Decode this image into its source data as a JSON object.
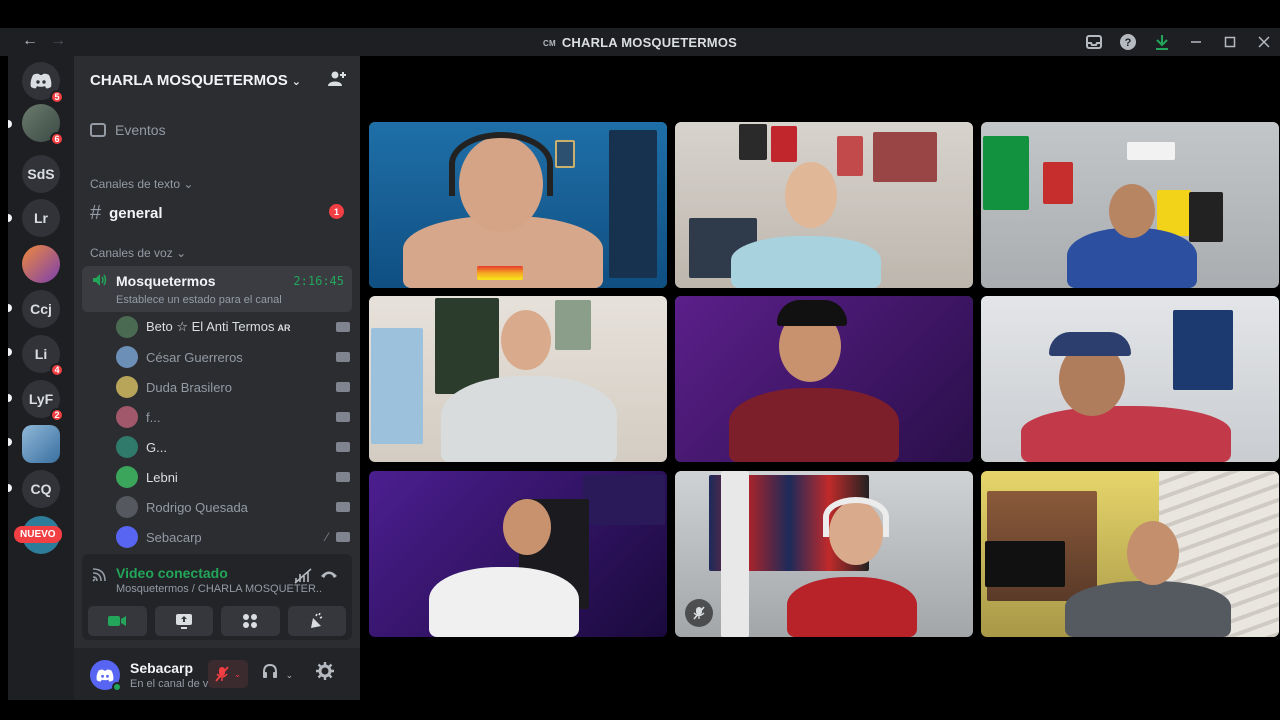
{
  "titlebar": {
    "back": "←",
    "forward": "→",
    "badge": "CM",
    "title": "CHARLA MOSQUETERMOS",
    "icons": [
      "inbox-icon",
      "help-icon",
      "download-icon",
      "minimize-icon",
      "maximize-icon",
      "close-icon"
    ]
  },
  "rail": {
    "guilds": [
      {
        "label": "",
        "icon": "discord-icon",
        "badge": "5"
      },
      {
        "label": "",
        "icon": "avatar",
        "badge": "6"
      },
      {
        "label": "SdS",
        "badge": ""
      },
      {
        "label": "Lr",
        "badge": ""
      },
      {
        "label": "",
        "icon": "avatar",
        "badge": ""
      },
      {
        "label": "Ccj",
        "badge": ""
      },
      {
        "label": "Li",
        "badge": "4"
      },
      {
        "label": "LyF",
        "badge": "2"
      },
      {
        "label": "",
        "icon": "avatar",
        "badge": ""
      },
      {
        "label": "CQ",
        "badge": ""
      }
    ],
    "new_label": "NUEVO"
  },
  "sidebar": {
    "server_name": "CHARLA MOSQUETERMOS",
    "events_label": "Eventos",
    "text_category": "Canales de texto",
    "text_channel": "general",
    "text_unread": "1",
    "voice_category": "Canales de voz",
    "voice_channel": {
      "name": "Mosquetermos",
      "time": "2:16:45",
      "status": "Establece un estado para el canal"
    },
    "members": [
      {
        "name": "Beto ☆ El Anti Termos",
        "flag": "AR",
        "bright": true,
        "icon": "camera-icon"
      },
      {
        "name": "César Guerreros",
        "flag": "",
        "bright": false,
        "icon": "camera-icon"
      },
      {
        "name": "Duda Brasilero",
        "flag": "",
        "bright": false,
        "icon": "camera-icon"
      },
      {
        "name": "f...",
        "flag": "",
        "bright": false,
        "icon": "camera-icon"
      },
      {
        "name": "G...",
        "flag": "",
        "bright": true,
        "icon": "camera-icon"
      },
      {
        "name": "Lebni",
        "flag": "",
        "bright": true,
        "icon": "camera-icon"
      },
      {
        "name": "Rodrigo Quesada",
        "flag": "",
        "bright": false,
        "icon": "camera-icon"
      },
      {
        "name": "Sebacarp",
        "flag": "",
        "bright": false,
        "icon": "camera-icon"
      }
    ]
  },
  "voice_panel": {
    "title": "Video conectado",
    "subtitle": "Mosquetermos / CHARLA MOSQUETER...",
    "buttons": [
      "camera-icon",
      "screen-share-icon",
      "activities-icon",
      "soundboard-icon"
    ]
  },
  "user": {
    "name": "Sebacarp",
    "status": "En el canal de voz"
  },
  "colors": {
    "green": "#23a55a",
    "red": "#f23f43",
    "blurple": "#5865f2"
  }
}
